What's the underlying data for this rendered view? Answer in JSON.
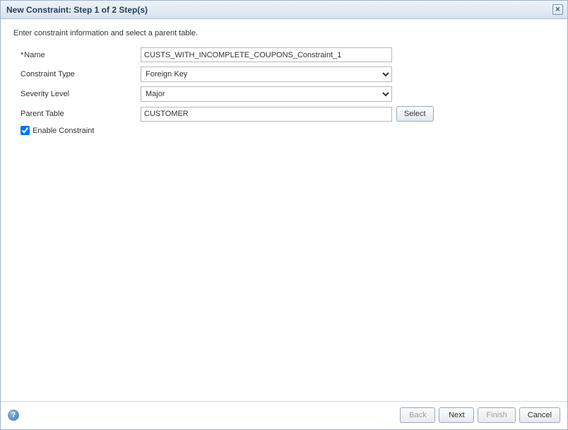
{
  "dialog": {
    "title": "New Constraint: Step 1 of 2 Step(s)"
  },
  "instruction": "Enter constraint information and select a parent table.",
  "form": {
    "name": {
      "label": "Name",
      "value": "CUSTS_WITH_INCOMPLETE_COUPONS_Constraint_1"
    },
    "constraint_type": {
      "label": "Constraint Type",
      "value": "Foreign Key"
    },
    "severity_level": {
      "label": "Severity Level",
      "value": "Major"
    },
    "parent_table": {
      "label": "Parent Table",
      "value": "CUSTOMER",
      "select_button": "Select"
    },
    "enable_constraint": {
      "label": "Enable Constraint",
      "checked": true
    }
  },
  "footer": {
    "back": "Back",
    "next": "Next",
    "finish": "Finish",
    "cancel": "Cancel"
  }
}
